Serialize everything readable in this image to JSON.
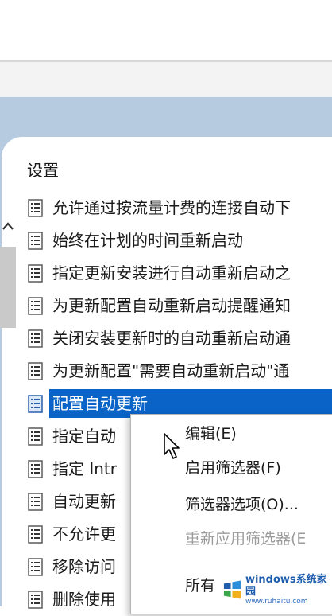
{
  "section": {
    "header": "设置"
  },
  "policies": [
    {
      "label": "允许通过按流量计费的连接自动下",
      "selected": false
    },
    {
      "label": "始终在计划的时间重新启动",
      "selected": false
    },
    {
      "label": "指定更新安装进行自动重新启动之",
      "selected": false
    },
    {
      "label": "为更新配置自动重新启动提醒通知",
      "selected": false
    },
    {
      "label": "关闭安装更新时的自动重新启动通",
      "selected": false
    },
    {
      "label": "为更新配置\"需要自动重新启动\"通",
      "selected": false
    },
    {
      "label": "配置自动更新",
      "selected": true
    },
    {
      "label": "指定自动",
      "selected": false
    },
    {
      "label": "指定 Intr",
      "selected": false
    },
    {
      "label": "自动更新",
      "selected": false
    },
    {
      "label": "不允许更",
      "selected": false
    },
    {
      "label": "移除访问",
      "selected": false
    },
    {
      "label": "删除使用",
      "selected": false
    }
  ],
  "context_menu": {
    "items": [
      {
        "label": "编辑(E)",
        "enabled": true
      },
      {
        "label": "启用筛选器(F)",
        "enabled": true
      },
      {
        "label": "筛选器选项(O)...",
        "enabled": true
      },
      {
        "label": "重新应用筛选器(E",
        "enabled": false
      },
      {
        "label": "所有",
        "enabled": true
      }
    ]
  },
  "watermark": {
    "title": "windows系统家园",
    "url": "www.ruhaitu.com"
  },
  "colors": {
    "selection": "#0a64c8",
    "backdrop": "#b7cbe0",
    "watermark_blue": "#1e5cad"
  }
}
